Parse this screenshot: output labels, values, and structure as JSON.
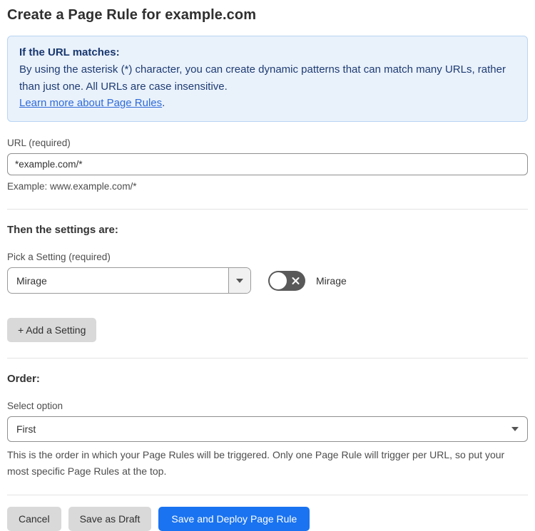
{
  "page": {
    "title": "Create a Page Rule for example.com"
  },
  "info_box": {
    "heading": "If the URL matches:",
    "body": "By using the asterisk (*) character, you can create dynamic patterns that can match many URLs, rather than just one. All URLs are case insensitive.",
    "link_label": "Learn more about Page Rules",
    "link_suffix": "."
  },
  "url_field": {
    "label": "URL (required)",
    "value": "*example.com/*",
    "helper": "Example: www.example.com/*"
  },
  "settings_section": {
    "heading": "Then the settings are:",
    "pick_label": "Pick a Setting (required)",
    "selected_setting": "Mirage",
    "toggle_label": "Mirage",
    "toggle_state": "off",
    "add_button_label": "+ Add a Setting"
  },
  "order_section": {
    "heading": "Order:",
    "label": "Select option",
    "selected_option": "First",
    "helper": "This is the order in which your Page Rules will be triggered. Only one Page Rule will trigger per URL, so put your most specific Page Rules at the top."
  },
  "footer": {
    "cancel_label": "Cancel",
    "save_draft_label": "Save as Draft",
    "deploy_label": "Save and Deploy Page Rule"
  },
  "colors": {
    "primary_blue": "#1a73f0",
    "info_bg": "#e9f1fb",
    "info_border": "#b9d5f3",
    "info_text": "#1e3c72",
    "link_blue": "#2f6bd8",
    "toggle_off_bg": "#595959"
  }
}
